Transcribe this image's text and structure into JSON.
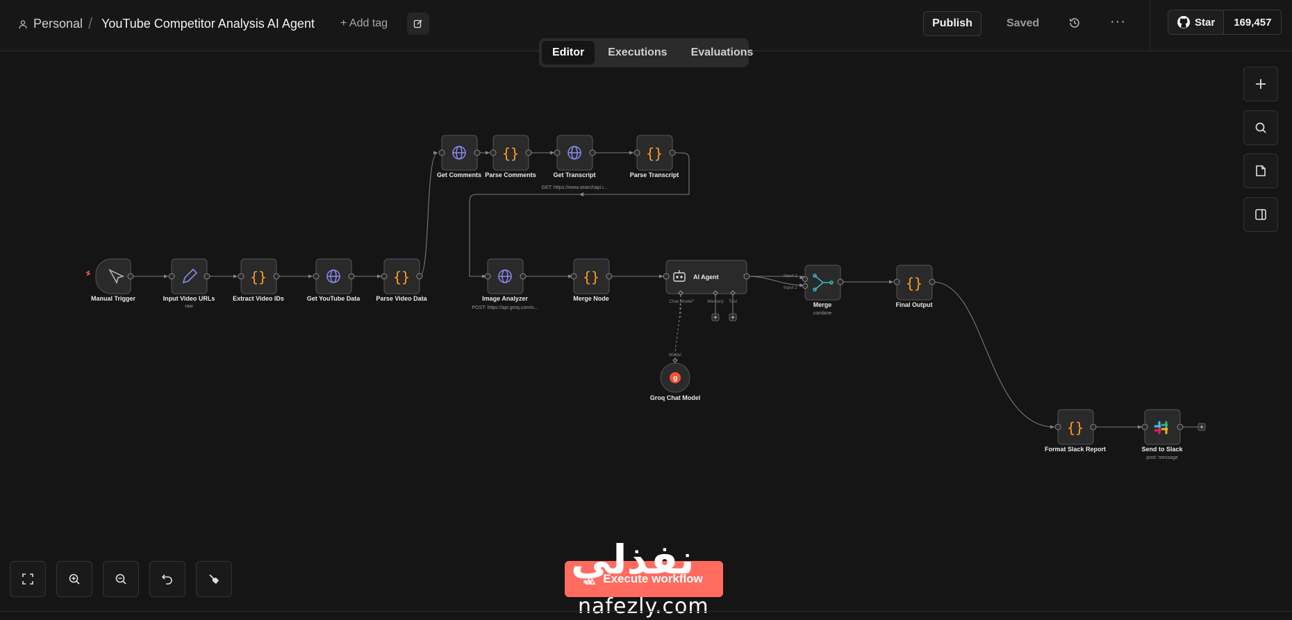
{
  "header": {
    "personal": "Personal",
    "title": "YouTube Competitor Analysis AI Agent",
    "add_tag": "+ Add tag",
    "publish": "Publish",
    "saved": "Saved",
    "star": "Star",
    "star_count": "169,457"
  },
  "tabs": [
    "Editor",
    "Executions",
    "Evaluations"
  ],
  "nodes": {
    "manual_trigger": {
      "label": "Manual Trigger"
    },
    "input_video_urls": {
      "label": "Input Video URLs",
      "sub": "raw"
    },
    "extract_video_ids": {
      "label": "Extract Video IDs"
    },
    "get_youtube_data": {
      "label": "Get YouTube Data"
    },
    "parse_video_data": {
      "label": "Parse Video Data"
    },
    "get_comments": {
      "label": "Get Comments"
    },
    "parse_comments": {
      "label": "Parse Comments"
    },
    "get_transcript": {
      "label": "Get Transcript",
      "sub": "GET: https://www.searchapi.i..."
    },
    "parse_transcript": {
      "label": "Parse Transcript"
    },
    "image_analyzer": {
      "label": "Image Analyzer",
      "sub": "POST: https://api.groq.com/o..."
    },
    "merge_node": {
      "label": "Merge Node"
    },
    "ai_agent": {
      "label": "AI Agent",
      "port_chat_model": "Chat Model",
      "port_memory": "Memory",
      "port_tool": "Tool"
    },
    "groq_chat_model": {
      "label": "Groq Chat Model",
      "port_model": "Model"
    },
    "merge": {
      "label": "Merge",
      "sub": "combine",
      "input1": "Input 1",
      "input2": "Input 2"
    },
    "final_output": {
      "label": "Final Output"
    },
    "format_slack_report": {
      "label": "Format Slack Report"
    },
    "send_to_slack": {
      "label": "Send to Slack",
      "sub": "post: message"
    }
  },
  "footer": {
    "execute": "Execute workflow",
    "watermark_ar": "نفذلي",
    "watermark_en": "nafezly.com"
  },
  "colors": {
    "background": "#151515",
    "node": "#2a2a2a",
    "code_brace": "#ff9b26",
    "http_globe": "#8b8cf5",
    "merge_icon": "#35b9c9",
    "groq": "#f55036",
    "execute": "#ff6b5f"
  }
}
